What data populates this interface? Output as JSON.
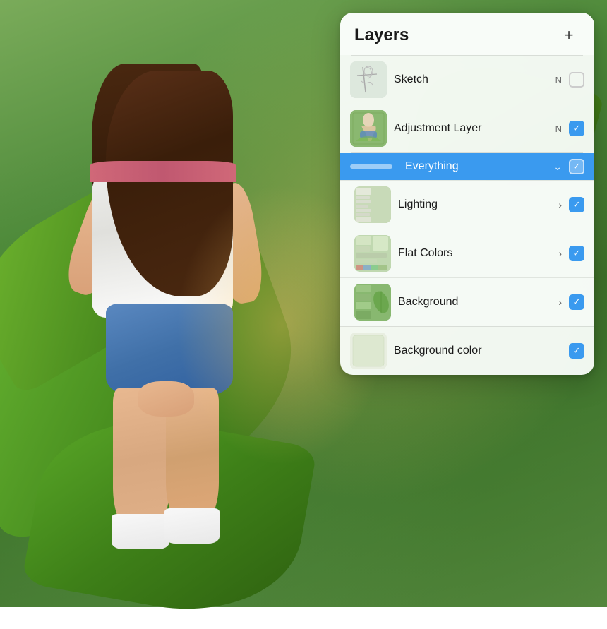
{
  "background": {
    "colors": {
      "primary": "#5a8a42",
      "secondary": "#4e8a3a",
      "leaf": "#6ab833"
    }
  },
  "layers_panel": {
    "title": "Layers",
    "add_button_label": "+",
    "layers": [
      {
        "id": "sketch",
        "name": "Sketch",
        "blend_mode": "N",
        "checked": false,
        "active": false,
        "thumbnail_type": "sketch",
        "expandable": false,
        "is_group": false
      },
      {
        "id": "adjustment-layer",
        "name": "Adjustment Layer",
        "blend_mode": "N",
        "checked": true,
        "active": false,
        "thumbnail_type": "adjustment",
        "expandable": false,
        "is_group": false
      },
      {
        "id": "everything",
        "name": "Everything",
        "blend_mode": "",
        "checked": true,
        "active": true,
        "thumbnail_type": "everything",
        "expandable": true,
        "expand_icon": "chevron-down",
        "is_group": true
      },
      {
        "id": "lighting",
        "name": "Lighting",
        "blend_mode": "",
        "checked": true,
        "active": false,
        "thumbnail_type": "lighting",
        "expandable": true,
        "expand_icon": "chevron-right",
        "is_group": true,
        "sub": true
      },
      {
        "id": "flat-colors",
        "name": "Flat Colors",
        "blend_mode": "",
        "checked": true,
        "active": false,
        "thumbnail_type": "flat",
        "expandable": true,
        "expand_icon": "chevron-right",
        "is_group": true,
        "sub": true
      },
      {
        "id": "background",
        "name": "Background",
        "blend_mode": "",
        "checked": true,
        "active": false,
        "thumbnail_type": "background",
        "expandable": true,
        "expand_icon": "chevron-right",
        "is_group": true,
        "sub": true
      },
      {
        "id": "background-color",
        "name": "Background color",
        "blend_mode": "",
        "checked": true,
        "active": false,
        "thumbnail_type": "bgcolor",
        "expandable": false,
        "is_group": false
      }
    ]
  }
}
